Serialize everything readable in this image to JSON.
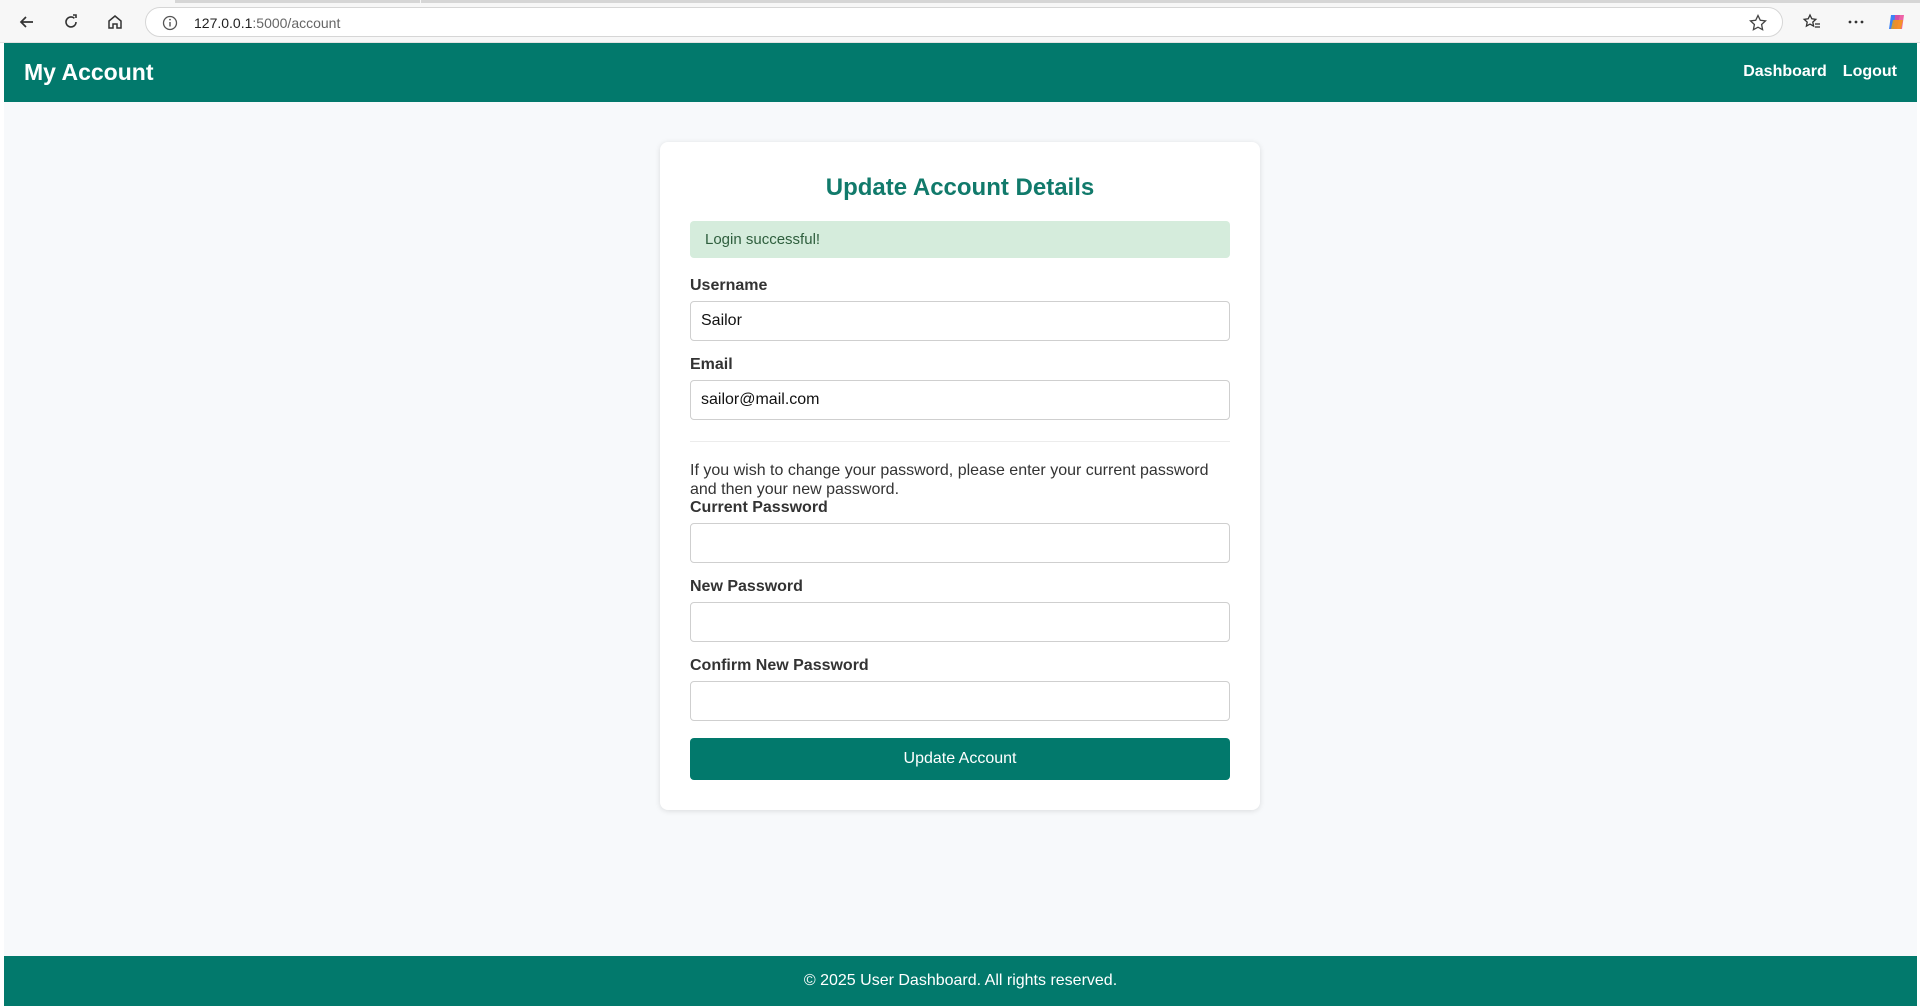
{
  "browser": {
    "url_host": "127.0.0.1",
    "url_path": ":5000/account"
  },
  "header": {
    "title": "My Account",
    "links": [
      "Dashboard",
      "Logout"
    ]
  },
  "form": {
    "title": "Update Account Details",
    "alert": "Login successful!",
    "username_label": "Username",
    "username_value": "Sailor",
    "email_label": "Email",
    "email_value": "sailor@mail.com",
    "help_text": "If you wish to change your password, please enter your current password and then your new password.",
    "current_password_label": "Current Password",
    "new_password_label": "New Password",
    "confirm_password_label": "Confirm New Password",
    "submit_label": "Update Account"
  },
  "footer": {
    "text": "© 2025 User Dashboard. All rights reserved."
  },
  "colors": {
    "brand": "#02796c",
    "success_bg": "#d5ecdc",
    "page_bg": "#f7f9fb"
  },
  "icons": [
    "back-icon",
    "reload-icon",
    "home-icon",
    "info-icon",
    "star-icon",
    "favorites-icon",
    "more-icon",
    "copilot-icon"
  ]
}
